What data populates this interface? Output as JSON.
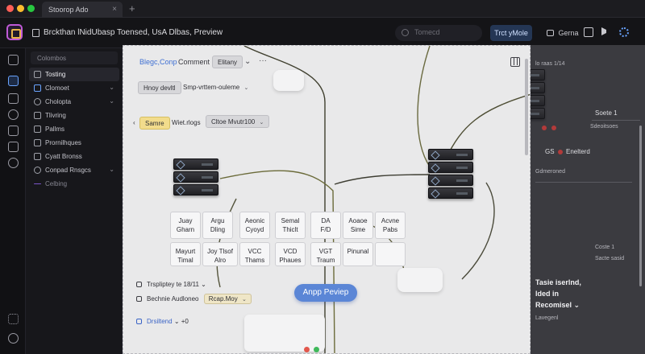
{
  "window": {
    "tab_title": "Stoorop Ado",
    "new_tab": "+",
    "close": "×"
  },
  "header": {
    "title": "Brckthan lNidUbasp Toensed, UsA Dlbas, Preview",
    "search_placeholder": "Tomecd",
    "primary_button": "Trct yMole",
    "comment_button": "Gerna"
  },
  "sidebar": {
    "filter": "Colombos",
    "items": [
      {
        "label": "Tosting"
      },
      {
        "label": "Clomoet"
      },
      {
        "label": "Cholopta"
      },
      {
        "label": "Tlivring"
      },
      {
        "label": "Pallms"
      },
      {
        "label": "Prornilhques"
      },
      {
        "label": "Cyatt Bronss"
      },
      {
        "label": "Conpad Rnsgcs"
      },
      {
        "label": "Celbing"
      }
    ]
  },
  "canvas": {
    "tabs": {
      "t1": "Blegc,Conp",
      "t2": "Comment",
      "t3": "Elitany",
      "more": "···"
    },
    "row1": {
      "chip1": "Hnoy devltl",
      "chip2": "Smp-vrttem-ouleme"
    },
    "row2": {
      "chip1": "Samre",
      "chip2": "Wiet.rlogs",
      "chip3": "Cltoe Mvutr100"
    },
    "cards_row1": [
      {
        "l1": "Juay",
        "l2": "Gharn"
      },
      {
        "l1": "Argu",
        "l2": "Dling"
      },
      {
        "l1": "Aeonic",
        "l2": "Cyoyd"
      },
      {
        "l1": "Semal",
        "l2": "Thiclt"
      },
      {
        "l1": "DA",
        "l2": "F/D"
      },
      {
        "l1": "Aoaoe",
        "l2": "Sime"
      },
      {
        "l1": "Acvne",
        "l2": "Pabs"
      }
    ],
    "cards_row2": [
      {
        "l1": "Mayurt",
        "l2": "Timal"
      },
      {
        "l1": "Joy Tlsof",
        "l2": "Alro"
      },
      {
        "l1": "VCC",
        "l2": "Thams"
      },
      {
        "l1": "VCD",
        "l2": "Phaues"
      },
      {
        "l1": "VGT",
        "l2": "Traum"
      },
      {
        "l1": "",
        "l2": "Pinunal"
      }
    ],
    "bottom": {
      "row1": "Trspliptey te 18/11",
      "row2_label": "Bechnie Audloneo",
      "row2_chip": "Rcap.Moy",
      "row3": "Drsiltend",
      "row3_suffix": "+0"
    },
    "preview_button": "Anpp Peviep"
  },
  "right_panel": {
    "top": "lo raas 1/14",
    "t1": "Soete 1",
    "t2": "Sdeoitsoes",
    "t3": "GS",
    "t4": "Enelterd",
    "t5": "Gdmeroned",
    "t6": "Coste 1",
    "t7": "Sacte sasid",
    "t8": "Tasie iserlnd,",
    "t9": "lded in",
    "t10": "Recomisel",
    "t11": "Lavegenl"
  },
  "colors": {
    "accent": "#5b86d6",
    "danger": "#b23a3a",
    "logo": "#c05ad8",
    "traffic_red": "#ff5f57",
    "traffic_yellow": "#febc2e",
    "traffic_green": "#28c840"
  }
}
